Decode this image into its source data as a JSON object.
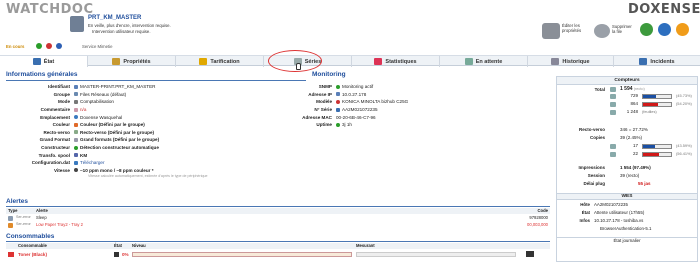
{
  "brand": {
    "left": "WATCHDOC",
    "right": "DOXENSE"
  },
  "header": {
    "printer": "PRT_KM_MASTER",
    "status": "En veille, plus d'encre, intervention requise.",
    "sub": "Intervention utilisateur requise.",
    "nav": "En cours",
    "pager": "Service Mimetie"
  },
  "actions": [
    {
      "label": "Éditer les propriétés"
    },
    {
      "label": "Supprimer la file"
    }
  ],
  "tabs": [
    "État",
    "Propriétés",
    "Tarification",
    "Séries",
    "Statistiques",
    "En attente",
    "Historique",
    "Incidents"
  ],
  "general": {
    "title": "Informations générales",
    "rows": [
      {
        "k": "Identifiant",
        "v": "MASTER-PRINT.PRT_KM_MASTER"
      },
      {
        "k": "Groupe",
        "v": "Files Réseaux (défaut)"
      },
      {
        "k": "Mode",
        "v": "Comptabilisation"
      },
      {
        "k": "Commentaire",
        "v": "n/a"
      },
      {
        "k": "Emplacement",
        "v": "Doxense Wasquehal"
      },
      {
        "k": "Couleur",
        "v": "Couleur (Défini par le groupe)"
      },
      {
        "k": "Recto-verso",
        "v": "Recto-verso (Défini par le groupe)"
      },
      {
        "k": "Grand Format",
        "v": "Grand formats (Défini par le groupe)"
      },
      {
        "k": "Constructeur",
        "v": "Détection constructeur automatique"
      },
      {
        "k": "Transfo. spool",
        "v": "KM"
      },
      {
        "k": "Configuration.dat",
        "v": "Télécharger"
      },
      {
        "k": "Vitesse",
        "v": "~10 ppm mono / ~8 ppm couleur *"
      }
    ],
    "note": "Vitesse calculée automatiquement, estimée d'après le type de périphérique"
  },
  "monitoring": {
    "title": "Monitoring",
    "rows": [
      {
        "k": "SNMP",
        "v": "Monitoring actif"
      },
      {
        "k": "Adresse IP",
        "v": "10.0.27.178"
      },
      {
        "k": "Modèle",
        "v": "KONICA MINOLTA bizhub C25G"
      },
      {
        "k": "N° Série",
        "v": "AA2M021072235"
      },
      {
        "k": "Adresse MAC",
        "v": "00-20-6B-46-C7-96"
      },
      {
        "k": "Uptime",
        "v": "3j 1h"
      }
    ]
  },
  "counters": {
    "title": "Compteurs",
    "total_label": "Total",
    "total": "1 594",
    "total_unit": "(recto)",
    "rows": [
      {
        "v": "729",
        "pct": "(45.73%)",
        "fill": 0.457,
        "color": "#1a4fa3"
      },
      {
        "v": "864",
        "pct": "(54.20%)",
        "fill": 0.542,
        "color": "#d01818"
      },
      {
        "v": "1 248",
        "pct": "(feuilles)",
        "fill": 0,
        "color": ""
      }
    ],
    "rv_label": "Recto-verso",
    "rv": "346 = 27.72%",
    "copies_label": "Copies",
    "copies": "39 (2.45%)",
    "crows": [
      {
        "v": "17",
        "pct": "(43.59%)",
        "fill": 0.436,
        "color": "#1a4fa3"
      },
      {
        "v": "22",
        "pct": "(56.41%)",
        "fill": 0.564,
        "color": "#d01818"
      }
    ],
    "imp_label": "Impressions",
    "imp": "1 554 (97.49%)",
    "ses_label": "Session",
    "ses": "39 (recto)",
    "delay_label": "Délai plug",
    "delay": "55 jas"
  },
  "wes": {
    "title": "WES",
    "host_k": "Hôte",
    "host": "AA2M021072235",
    "state_k": "État",
    "state": "Attente utilisateur (17h55)",
    "info_k": "Infos",
    "info": "10.10.27.178 - toshiba.vs",
    "auth": "BrowserAuthentication-5.1",
    "journal": "État journalier"
  },
  "alerts": {
    "title": "Alertes",
    "col1": "Type",
    "col2": "Alerte",
    "col3": "Code",
    "rows": [
      {
        "type": "Ser-error",
        "text": "Sleep",
        "code": "97928000",
        "color": "#222"
      },
      {
        "type": "Ser-error",
        "text": "Low Paper Tray2 - Tray 2",
        "code": "00,003,000",
        "color": "#d33"
      }
    ]
  },
  "consumables": {
    "title": "Consommables",
    "h1": "Consommable",
    "h2": "État",
    "h3": "Niveau",
    "h4": "Mesurant",
    "row": {
      "name": "Toner (Black)",
      "state": "0%",
      "level": 0
    }
  }
}
